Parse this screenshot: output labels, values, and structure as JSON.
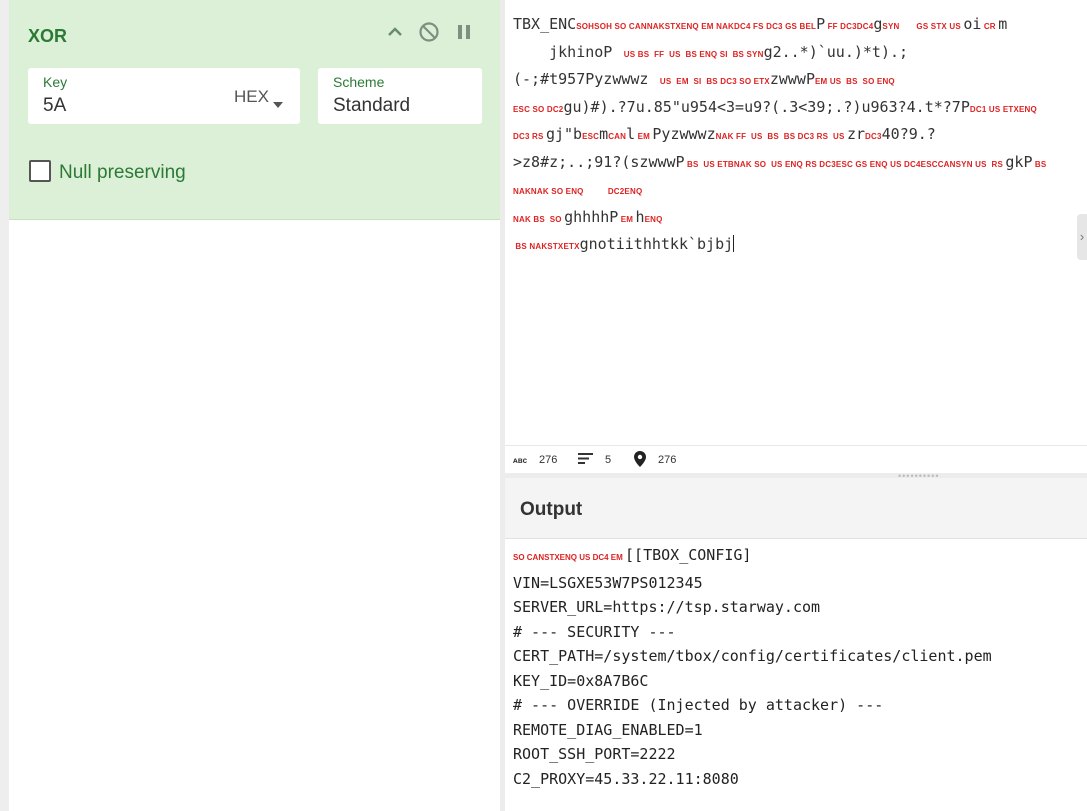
{
  "operation": {
    "title": "XOR",
    "key_label": "Key",
    "key_value": "5A",
    "key_type": "HEX",
    "scheme_label": "Scheme",
    "scheme_value": "Standard",
    "null_preserving_label": "Null preserving",
    "null_preserving_checked": false
  },
  "input": {
    "lines": [
      {
        "tokens": [
          {
            "t": "TBX_ENC"
          },
          {
            "c": "SOHSOH SO CANNAKSTXENQ EM NAKDC4 FS DC3 GS BEL"
          },
          {
            "t": "P"
          },
          {
            "c": " FF DC3DC4"
          },
          {
            "t": "g"
          },
          {
            "c": "SYN       GS STX US "
          },
          {
            "t": "oi"
          },
          {
            "c": " CR "
          },
          {
            "t": "m"
          }
        ]
      },
      {
        "tokens": [
          {
            "t": "    jkhinoP "
          },
          {
            "c": " US BS  FF  US  BS ENQ SI  BS SYN"
          },
          {
            "t": "g2..*)`uu.)*t).;"
          }
        ]
      },
      {
        "tokens": [
          {
            "t": "(-;#t957Pyzwwwz "
          },
          {
            "c": " US  EM  SI  BS DC3 SO ETX"
          },
          {
            "t": "zwwwP"
          },
          {
            "c": "EM US  BS  SO ENQ"
          }
        ]
      },
      {
        "tokens": [
          {
            "c": "ESC SO DC2"
          },
          {
            "t": "gu)#).?7u.85\"u954<3=u9?(.3<39;.?)u963?4.t*?7P"
          },
          {
            "c": "DC1 US ETXENQ"
          }
        ]
      },
      {
        "tokens": [
          {
            "c": "DC3 RS "
          },
          {
            "t": "gj\"b"
          },
          {
            "c": "ESC"
          },
          {
            "t": "m"
          },
          {
            "c": "CAN"
          },
          {
            "t": "l"
          },
          {
            "c": " EM "
          },
          {
            "t": "Pyzwwwz"
          },
          {
            "c": "NAK FF  US  BS  BS DC3 RS  US "
          },
          {
            "t": "zr"
          },
          {
            "c": "DC3"
          },
          {
            "t": "40?9.?"
          }
        ]
      },
      {
        "tokens": [
          {
            "t": ">z8#z;..;91?(szwwwP"
          },
          {
            "c": " BS  US ETBNAK SO  US ENQ RS DC3ESC GS ENQ US DC4ESCCANSYN US  RS "
          },
          {
            "t": "gkP"
          },
          {
            "c": " BS"
          }
        ]
      },
      {
        "tokens": [
          {
            "c": "NAKNAK SO ENQ          DC2ENQ"
          }
        ]
      },
      {
        "tokens": [
          {
            "c": "NAK BS  SO "
          },
          {
            "t": "ghhhhP"
          },
          {
            "c": " EM "
          },
          {
            "t": "h"
          },
          {
            "c": "ENQ"
          }
        ]
      },
      {
        "tokens": [
          {
            "c": " BS NAKSTXETX"
          },
          {
            "t": "gnotiithhtkk`bjbj"
          }
        ]
      }
    ]
  },
  "status": {
    "char_count": "276",
    "line_count": "5",
    "position": "276"
  },
  "output": {
    "title": "Output",
    "first_line_controls": "SO CANSTXENQ US DC4 EM ",
    "first_line_text": "[[TBOX_CONFIG]",
    "lines": [
      "VIN=LSGXE53W7PS012345",
      "SERVER_URL=https://tsp.starway.com",
      "# --- SECURITY ---",
      "CERT_PATH=/system/tbox/config/certificates/client.pem",
      "KEY_ID=0x8A7B6C",
      "# --- OVERRIDE (Injected by attacker) ---",
      "REMOTE_DIAG_ENABLED=1",
      "ROOT_SSH_PORT=2222",
      "C2_PROXY=45.33.22.11:8080"
    ]
  },
  "icons": {
    "collapse": "chevron-up-icon",
    "disable": "disable-icon",
    "pause": "pause-icon",
    "char_count": "abc-icon",
    "lines": "lines-icon",
    "position": "location-pin-icon"
  },
  "colors": {
    "op_background": "#dcf0d7",
    "op_accent": "#2c7a36",
    "control_char": "#dd2222"
  }
}
